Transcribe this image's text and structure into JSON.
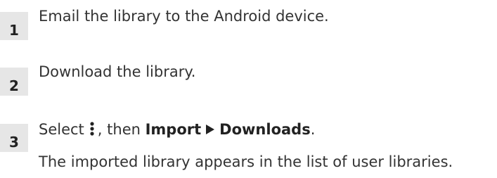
{
  "steps": [
    {
      "number": "1",
      "text": "Email the library to the Android device."
    },
    {
      "number": "2",
      "text": "Download the library."
    },
    {
      "number": "3",
      "prefix": "Select",
      "icon": "more-vertical-icon",
      "middle": ", then",
      "menu_item": "Import",
      "separator_icon": "right-triangle-icon",
      "submenu_item": "Downloads",
      "suffix": "."
    }
  ],
  "result": "The imported library appears in the list of user libraries."
}
